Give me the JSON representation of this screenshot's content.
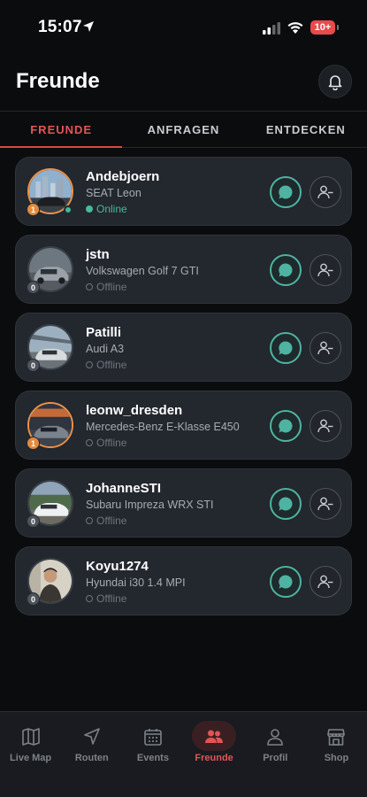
{
  "status_bar": {
    "time": "15:07",
    "battery": "10+"
  },
  "header": {
    "title": "Freunde"
  },
  "tabs": [
    {
      "label": "FREUNDE",
      "active": true
    },
    {
      "label": "ANFRAGEN",
      "active": false
    },
    {
      "label": "ENTDECKEN",
      "active": false
    }
  ],
  "friends": [
    {
      "name": "Andebjoern",
      "car": "SEAT Leon",
      "status": "Online",
      "level": "1"
    },
    {
      "name": "jstn",
      "car": "Volkswagen Golf 7 GTI",
      "status": "Offline",
      "level": "0"
    },
    {
      "name": "Patilli",
      "car": "Audi A3",
      "status": "Offline",
      "level": "0"
    },
    {
      "name": "leonw_dresden",
      "car": "Mercedes-Benz E-Klasse E450",
      "status": "Offline",
      "level": "1"
    },
    {
      "name": "JohanneSTI",
      "car": "Subaru Impreza WRX STI",
      "status": "Offline",
      "level": "0"
    },
    {
      "name": "Koyu1274",
      "car": "Hyundai i30 1.4 MPI",
      "status": "Offline",
      "level": "0"
    }
  ],
  "nav": [
    {
      "label": "Live Map",
      "icon": "map-icon"
    },
    {
      "label": "Routen",
      "icon": "navigation-arrow-icon"
    },
    {
      "label": "Events",
      "icon": "calendar-icon"
    },
    {
      "label": "Freunde",
      "icon": "people-icon",
      "active": true
    },
    {
      "label": "Profil",
      "icon": "person-icon"
    },
    {
      "label": "Shop",
      "icon": "store-icon"
    }
  ],
  "colors": {
    "accent": "#e25555",
    "online": "#48b99d",
    "chat_ring": "#4fb3a2",
    "card_bg": "#23272e"
  }
}
